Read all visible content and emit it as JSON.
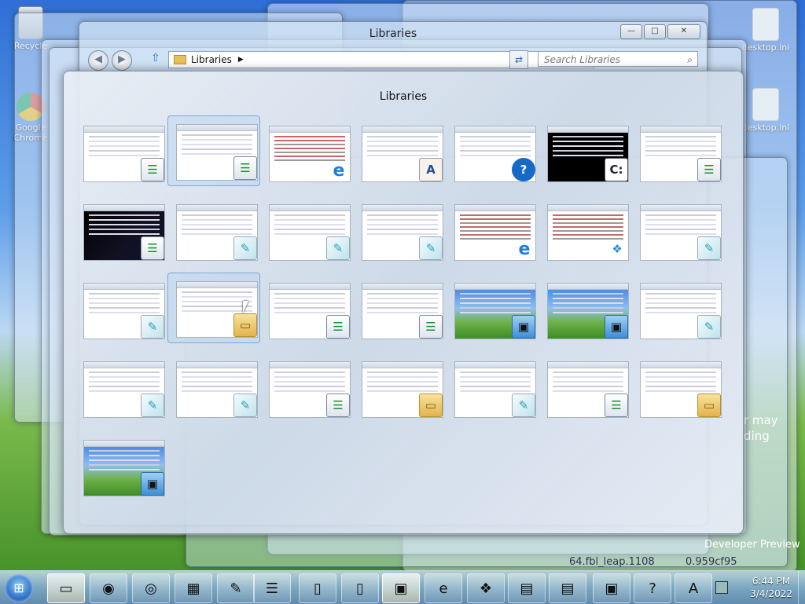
{
  "desktop": {
    "icons": [
      {
        "name": "recycle",
        "label": "Recycle"
      },
      {
        "name": "chrome",
        "label": "Google Chrome"
      },
      {
        "name": "desktop-ini-1",
        "label": "desktop.ini"
      },
      {
        "name": "desktop-ini-2",
        "label": "desktop.ini"
      }
    ],
    "bg_text": {
      "line1": "r may",
      "line2": "ding",
      "dev_preview": "Developer Preview",
      "build": "64.fbl_leap.1108",
      "hash": "0.959cf95"
    }
  },
  "explorer": {
    "title": "Libraries",
    "path": "Libraries",
    "search_placeholder": "Search Libraries",
    "caption": {
      "minimize": "—",
      "maximize": "□",
      "close": "✕"
    }
  },
  "switcher": {
    "title": "Libraries",
    "thumbnails": [
      {
        "icon": "list-icon",
        "badge": "☰"
      },
      {
        "icon": "list-icon",
        "badge": "☰",
        "selected": true
      },
      {
        "icon": "ie-icon",
        "badge": "e"
      },
      {
        "icon": "word-icon",
        "badge": "A"
      },
      {
        "icon": "help-icon",
        "badge": "?"
      },
      {
        "icon": "cmd-icon",
        "badge": "C:"
      },
      {
        "icon": "list-icon",
        "badge": "☰"
      },
      {
        "icon": "list-icon",
        "badge": "☰"
      },
      {
        "icon": "note-icon",
        "badge": "✎"
      },
      {
        "icon": "note-icon",
        "badge": "✎"
      },
      {
        "icon": "note-icon",
        "badge": "✎"
      },
      {
        "icon": "ie-icon",
        "badge": "e"
      },
      {
        "icon": "registry-icon",
        "badge": "❖"
      },
      {
        "icon": "note-icon",
        "badge": "✎"
      },
      {
        "icon": "note-icon",
        "badge": "✎"
      },
      {
        "icon": "folder-icon",
        "badge": "▭",
        "selected": true
      },
      {
        "icon": "list-icon",
        "badge": "☰"
      },
      {
        "icon": "list-icon",
        "badge": "☰"
      },
      {
        "icon": "picture-icon",
        "badge": "▣"
      },
      {
        "icon": "picture-icon",
        "badge": "▣"
      },
      {
        "icon": "note-icon",
        "badge": "✎"
      },
      {
        "icon": "note-icon",
        "badge": "✎"
      },
      {
        "icon": "note-icon",
        "badge": "✎"
      },
      {
        "icon": "list-icon",
        "badge": "☰"
      },
      {
        "icon": "user-folder-icon",
        "badge": "▭"
      },
      {
        "icon": "note-icon",
        "badge": "✎"
      },
      {
        "icon": "list-icon",
        "badge": "☰"
      },
      {
        "icon": "folder-icon",
        "badge": "▭"
      },
      {
        "icon": "picture-icon",
        "badge": "▣"
      }
    ]
  },
  "taskbar": {
    "start_glyph": "⊞",
    "buttons": [
      {
        "name": "explorer",
        "glyph": "▭",
        "active": true
      },
      {
        "name": "firefox",
        "glyph": "◉"
      },
      {
        "name": "chrome",
        "glyph": "◎"
      },
      {
        "name": "control-panel",
        "glyph": "▦"
      },
      {
        "name": "notepad",
        "glyph": "✎"
      },
      {
        "name": "list",
        "glyph": "☰"
      },
      {
        "name": "document-1",
        "glyph": "▯"
      },
      {
        "name": "document-2",
        "glyph": "▯"
      },
      {
        "name": "pictures",
        "glyph": "▣",
        "active": true
      },
      {
        "name": "ie",
        "glyph": "e"
      },
      {
        "name": "registry",
        "glyph": "❖"
      },
      {
        "name": "cmd-1",
        "glyph": "▤"
      },
      {
        "name": "cmd-2",
        "glyph": "▤"
      },
      {
        "name": "taskmgr",
        "glyph": "▣"
      },
      {
        "name": "help",
        "glyph": "?"
      },
      {
        "name": "wordpad",
        "glyph": "A"
      }
    ],
    "clock": {
      "time": "6:44 PM",
      "date": "3/4/2022"
    }
  }
}
